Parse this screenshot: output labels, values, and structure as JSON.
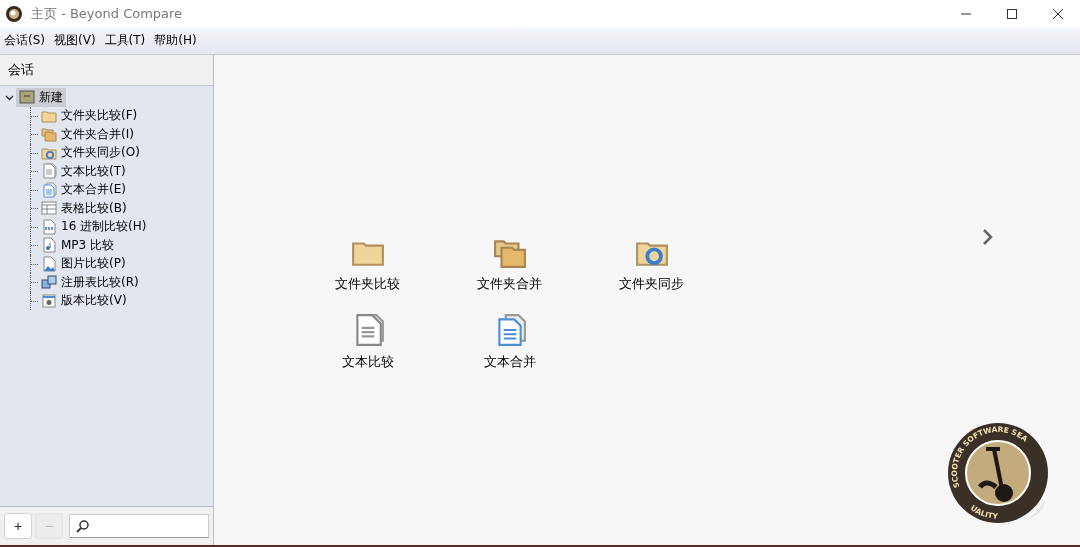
{
  "window": {
    "title": "主页 - Beyond Compare"
  },
  "menu": [
    "会话(S)",
    "视图(V)",
    "工具(T)",
    "帮助(H)"
  ],
  "sidebar": {
    "header": "会话",
    "tree": {
      "label": "新建",
      "selected": true,
      "expanded": true,
      "children": [
        {
          "label": "文件夹比较(F)",
          "kind": "folder",
          "selected": false
        },
        {
          "label": "文件夹合并(I)",
          "kind": "folder-merge",
          "selected": false
        },
        {
          "label": "文件夹同步(O)",
          "kind": "folder-sync",
          "selected": false
        },
        {
          "label": "文本比较(T)",
          "kind": "text",
          "selected": false
        },
        {
          "label": "文本合并(E)",
          "kind": "text-merge",
          "selected": false
        },
        {
          "label": "表格比较(B)",
          "kind": "table",
          "selected": false
        },
        {
          "label": "16 进制比较(H)",
          "kind": "hex",
          "selected": false
        },
        {
          "label": "MP3 比较",
          "kind": "mp3",
          "selected": false
        },
        {
          "label": "图片比较(P)",
          "kind": "image",
          "selected": false
        },
        {
          "label": "注册表比较(R)",
          "kind": "registry",
          "selected": false
        },
        {
          "label": "版本比较(V)",
          "kind": "version",
          "selected": false
        }
      ]
    },
    "toolbar": [
      {
        "label": "+",
        "disabled": false
      },
      {
        "label": "−",
        "disabled": true
      }
    ]
  },
  "launcher": [
    [
      {
        "label": "文件夹比较",
        "kind": "folder"
      },
      {
        "label": "文件夹合并",
        "kind": "folder-merge"
      },
      {
        "label": "文件夹同步",
        "kind": "folder-sync"
      }
    ],
    [
      {
        "label": "文本比较",
        "kind": "text"
      },
      {
        "label": "文本合并",
        "kind": "text-merge"
      }
    ]
  ],
  "seal": {
    "top_text": "SCOOTER SOFTWARE SEA",
    "bottom_text": "UALITY"
  }
}
